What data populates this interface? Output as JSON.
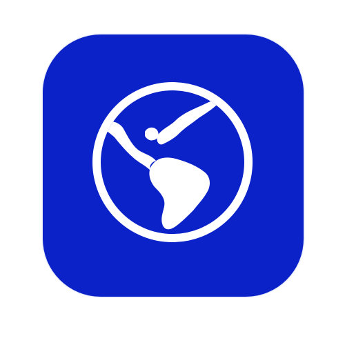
{
  "app_icon": {
    "icon": "globe-americas-icon",
    "tile_color": "#0a22c8",
    "glyph_color": "#ffffff",
    "background_color": "#ffffff"
  }
}
